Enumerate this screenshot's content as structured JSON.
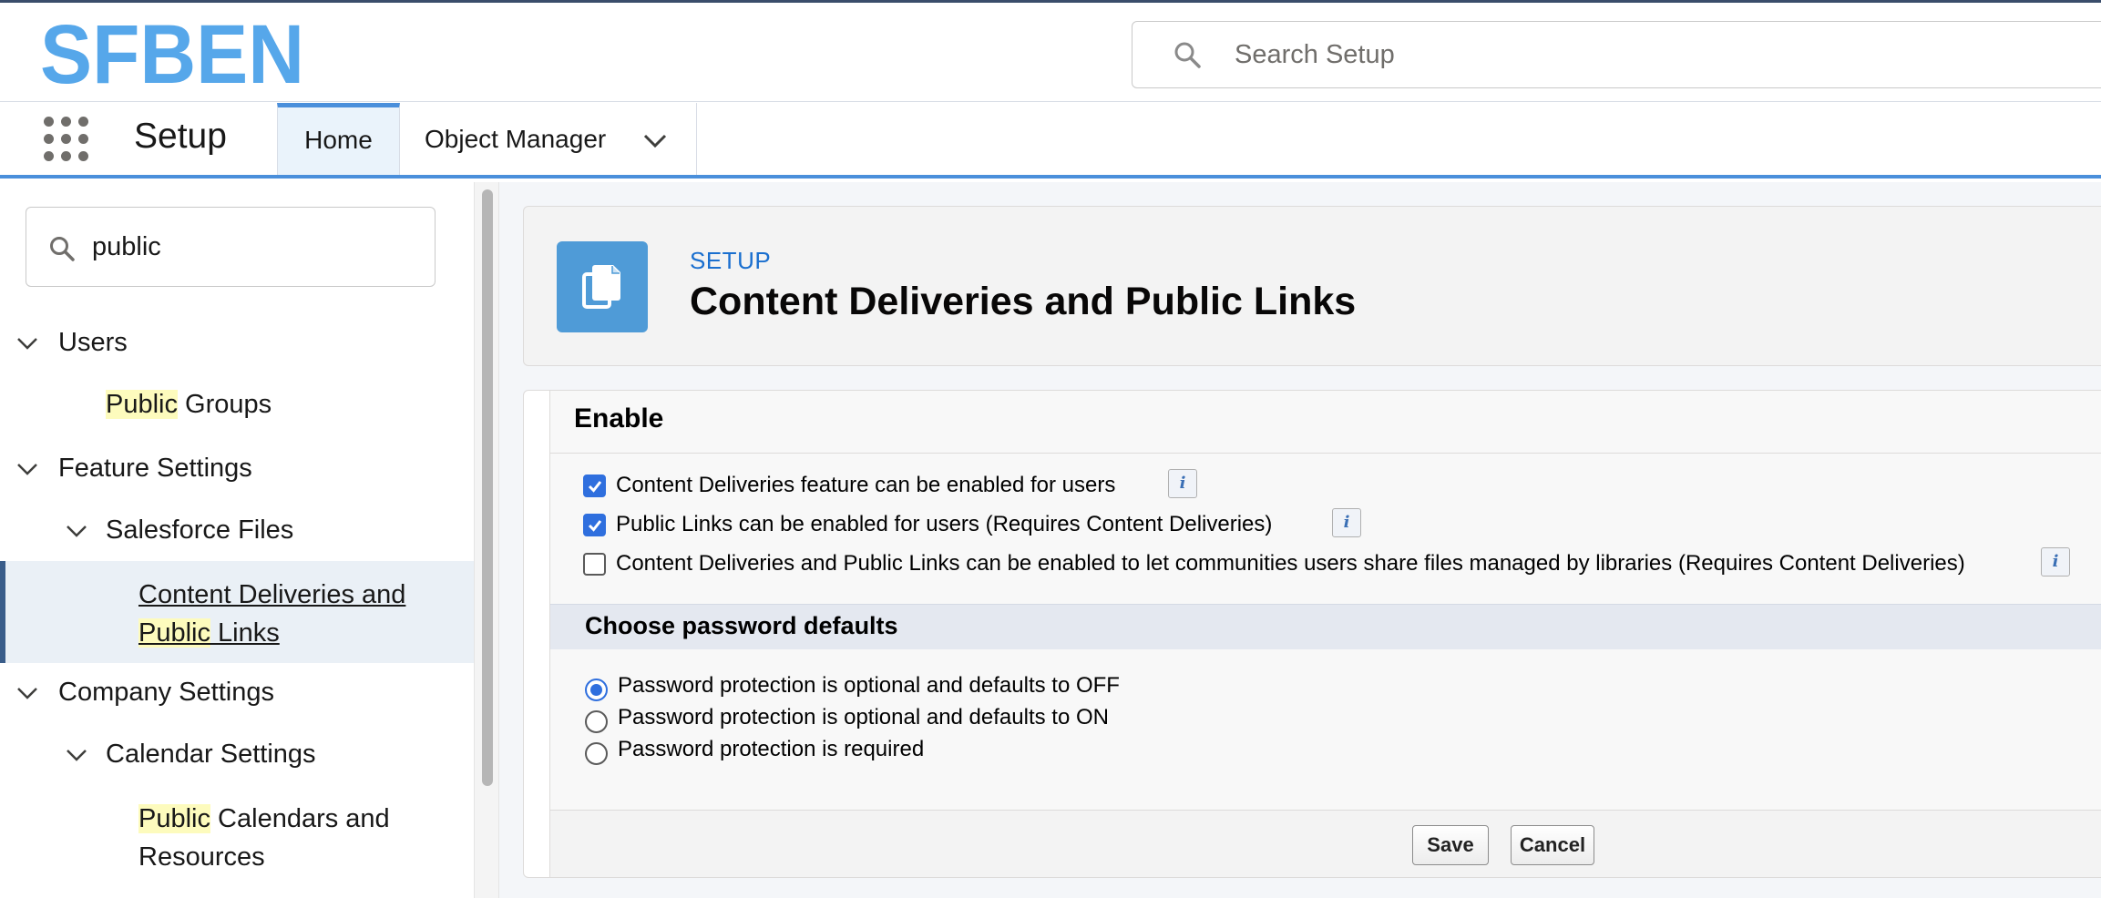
{
  "brand": {
    "logo_text": "SFBEN",
    "logo_color": "#56a7ea"
  },
  "global_search": {
    "placeholder": "Search Setup"
  },
  "nav": {
    "app_name": "Setup",
    "tabs": [
      {
        "label": "Home",
        "active": true
      },
      {
        "label": "Object Manager",
        "has_dropdown": true
      }
    ]
  },
  "sidebar": {
    "quick_find_value": "public",
    "tree": {
      "users": "Users",
      "public_groups_hl": "Public",
      "public_groups_rest": " Groups",
      "feature_settings": "Feature Settings",
      "salesforce_files": "Salesforce Files",
      "cd_line1": "Content Deliveries and",
      "cd_line2_hl": "Public",
      "cd_line2_rest": " Links",
      "company_settings": "Company Settings",
      "calendar_settings": "Calendar Settings",
      "pcr_line1_hl": "Public",
      "pcr_line1_rest": " Calendars and",
      "pcr_line2": "Resources"
    }
  },
  "page_header": {
    "kicker": "SETUP",
    "title": "Content Deliveries and Public Links",
    "icon": "file-copy-icon"
  },
  "enable_section": {
    "title": "Enable",
    "options": [
      {
        "label": "Content Deliveries feature can be enabled for users",
        "checked": true
      },
      {
        "label": "Public Links can be enabled for users (Requires Content Deliveries)",
        "checked": true
      },
      {
        "label": "Content Deliveries and Public Links can be enabled to let communities users share files managed by libraries (Requires Content Deliveries)",
        "checked": false
      }
    ],
    "info_glyph": "i"
  },
  "password_section": {
    "title": "Choose password defaults",
    "options": [
      {
        "label": "Password protection is optional and defaults to OFF",
        "selected": true
      },
      {
        "label": "Password protection is optional and defaults to ON",
        "selected": false
      },
      {
        "label": "Password protection is required",
        "selected": false
      }
    ]
  },
  "buttons": {
    "save": "Save",
    "cancel": "Cancel"
  },
  "colors": {
    "accent": "#4a8fdb",
    "checkbox": "#2f6fde",
    "highlight": "#fdfbbd",
    "header_icon": "#4f9bd7"
  }
}
